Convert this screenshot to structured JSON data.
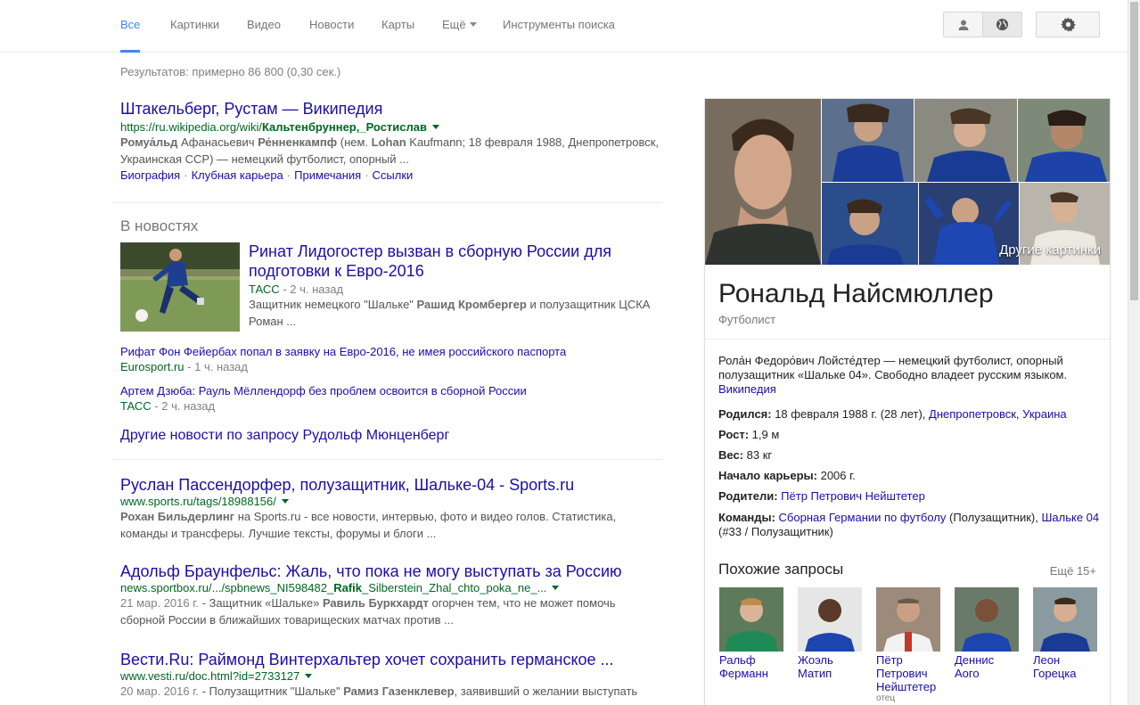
{
  "tabs": [
    {
      "label": "Все"
    },
    {
      "label": "Картинки"
    },
    {
      "label": "Видео"
    },
    {
      "label": "Новости"
    },
    {
      "label": "Карты"
    },
    {
      "label": "Ещё"
    },
    {
      "label": "Инструменты поиска"
    }
  ],
  "stats": "Результатов: примерно 86 800 (0,30 сек.)",
  "result1": {
    "title": "Штакельберг, Рустам — Википедия",
    "url_prefix": "https://ru.wikipedia.org/wiki/",
    "url_bold": "Кальтенбруннер,_Ростислав",
    "snippet_b1": "Ромуа́льд",
    "snippet_t1": " Афанасьевич ",
    "snippet_b2": "Ре́нненкампф",
    "snippet_t2": " (нем. ",
    "snippet_b3": "Lohan",
    "snippet_t3": " Kaufmann; 18 февраля 1988, Днепропетровск, Украинская ССР) — немецкий футболист, опорный ...",
    "sitelinks": [
      "Биография",
      "Клубная карьера",
      "Примечания",
      "Ссылки"
    ]
  },
  "news": {
    "heading": "В новостях",
    "main_title": "Ринат Лидогостер вызван в сборную России для подготовки к Евро-2016",
    "main_source": "ТАСС",
    "main_time": " - 2 ч. назад",
    "main_snip_t1": "Защитник немецкого \"Шальке\" ",
    "main_snip_b1": "Рашид Кромбергер",
    "main_snip_t2": " и полузащитник ЦСКА Роман ...",
    "item2_title": "Рифат Фон Фейербах попал в заявку на Евро-2016, не имея российского паспорта",
    "item2_source": "Eurosport.ru",
    "item2_time": " - 1 ч. назад",
    "item3_title": "Артем Дзюба: Рауль Мёллендорф без проблем освоится в сборной России",
    "item3_source": "ТАСС",
    "item3_time": " - 2 ч. назад",
    "more": "Другие новости по запросу Рудольф Мюнценберг"
  },
  "result2": {
    "title": "Руслан Пассендорфер, полузащитник, Шальке-04 - Sports.ru",
    "url": "www.sports.ru/tags/18988156/",
    "snip_b1": "Рохан Бильдерлинг",
    "snip_t1": " на Sports.ru - все новости, интервью, фото и видео голов. Статистика, команды и трансферы. Лучшие тексты, форумы и блоги ..."
  },
  "result3": {
    "title": "Адольф Браунфельс: Жаль, что пока не могу выступать за Россию",
    "url_prefix": "news.sportbox.ru/.../spbnews_NI598482_",
    "url_bold": "Rafik",
    "url_suffix": "_Silberstein_Zhal_chto_poka_ne_...",
    "date": "21 мар. 2016 г.",
    "snip_t1": " - Защитник «Шальке» ",
    "snip_b1": "Равиль Буркхардт",
    "snip_t2": " огорчен тем, что не может помочь сборной России в ближайших товарищеских матчах против ..."
  },
  "result4": {
    "title": "Вести.Ru: Раймонд Винтерхальтер хочет сохранить германское ...",
    "url": "www.vesti.ru/doc.html?id=2733127",
    "date": "20 мар. 2016 г.",
    "snip_t1": " - Полузащитник \"Шальке\" ",
    "snip_b1": "Рамиз Газенклевер",
    "snip_t2": ", заявивший о желании выступать"
  },
  "kp": {
    "more_images": "Другие картинки",
    "title": "Рональд Найсмюллер",
    "subtitle": "Футболист",
    "desc": "Рола́н Федоро́вич Лойсте́дтер — немецкий футболист, опорный полузащитник «Шальке 04». Свободно владеет русским языком.",
    "desc_link": "Википедия",
    "born_label": "Родился:",
    "born_value": " 18 февраля 1988 г. (28 лет), ",
    "born_link": "Днепропетровск, Украина",
    "height_label": "Рост:",
    "height_value": " 1,9 м",
    "weight_label": "Вес:",
    "weight_value": " 83 кг",
    "career_label": "Начало карьеры:",
    "career_value": " 2006 г.",
    "parents_label": "Родители:",
    "parents_link": "Пётр Петрович Нейштетер",
    "teams_label": "Команды:",
    "teams_link1": "Сборная Германии по футболу",
    "teams_t1": " (Полузащитник), ",
    "teams_link2": "Шальке 04",
    "teams_t2": " (#33 / Полузащитник)",
    "related_heading": "Похожие запросы",
    "related_more": "Ещё 15+",
    "related": [
      {
        "name": "Ральф Ферманн",
        "sub": ""
      },
      {
        "name": "Жоэль Матип",
        "sub": ""
      },
      {
        "name": "Пётр Петрович Нейштетер",
        "sub": "отец"
      },
      {
        "name": "Деннис Аого",
        "sub": ""
      },
      {
        "name": "Леон Горецка",
        "sub": ""
      }
    ]
  },
  "colors": {
    "accent": "#4285f4",
    "link": "#1a0dab",
    "url": "#006621",
    "snippet": "#545454"
  }
}
